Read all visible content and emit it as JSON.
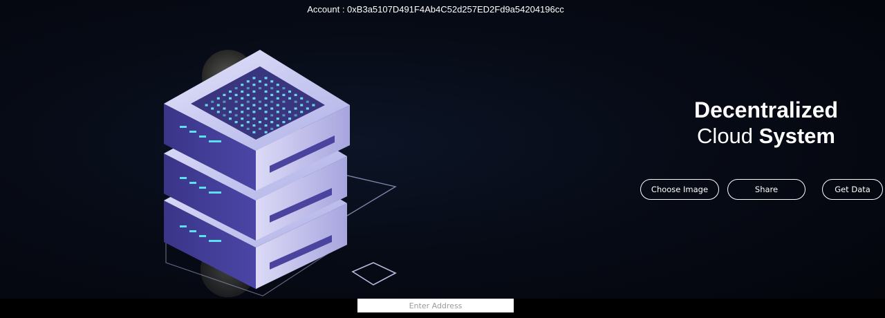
{
  "header": {
    "account_text": "Account : 0xB3a5107D491F4Ab4C52d257ED2Fd9a54204196cc"
  },
  "hero": {
    "title_line1": "Decentralized",
    "title_line2_regular": "Cloud ",
    "title_line2_bold": "System",
    "illustration_icon": "server-stack-icon"
  },
  "actions": {
    "choose_image": "Choose Image",
    "share": "Share",
    "get_data": "Get Data"
  },
  "address": {
    "placeholder": "Enter Address",
    "value": ""
  },
  "colors": {
    "background": "#050812",
    "text": "#ffffff",
    "server_face": "#c9c8f0",
    "server_side": "#3c3a8c",
    "led_accent": "#5fe0f0"
  }
}
